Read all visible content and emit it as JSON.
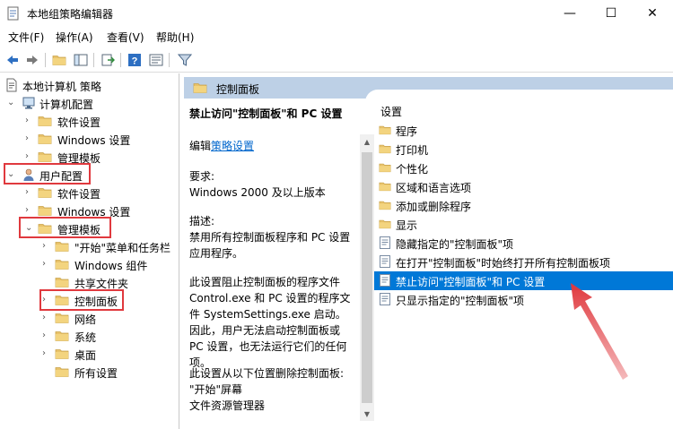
{
  "window": {
    "title": "本地组策略编辑器",
    "minimize": "—",
    "maximize": "☐",
    "close": "✕"
  },
  "menu": [
    "文件(F)",
    "操作(A)",
    "查看(V)",
    "帮助(H)"
  ],
  "toolbar": {
    "icons": [
      "back-arrow-icon",
      "forward-arrow-icon",
      "up-folder-icon",
      "show-hide-tree-icon",
      "export-list-icon",
      "help-icon",
      "properties-icon",
      "filter-icon"
    ]
  },
  "tree": {
    "root": "本地计算机 策略",
    "computer_config": "计算机配置",
    "cc_software": "软件设置",
    "cc_windows": "Windows 设置",
    "cc_admin": "管理模板",
    "user_config": "用户配置",
    "uc_software": "软件设置",
    "uc_windows": "Windows 设置",
    "uc_admin": "管理模板",
    "start_menu": "\"开始\"菜单和任务栏",
    "windows_components": "Windows 组件",
    "shared_folders": "共享文件夹",
    "control_panel": "控制面板",
    "network": "网络",
    "system": "系统",
    "desktop": "桌面",
    "all_settings": "所有设置"
  },
  "detail": {
    "header": "控制面板",
    "policy_title": "禁止访问\"控制面板\"和 PC 设置",
    "edit_prefix": "编辑",
    "edit_link": "策略设置",
    "req_label": "要求:",
    "req_value": "Windows 2000 及以上版本",
    "desc_label": "描述:",
    "desc_text": "禁用所有控制面板程序和 PC 设置应用程序。",
    "desc_more": "此设置阻止控制面板的程序文件 Control.exe 和 PC 设置的程序文件 SystemSettings.exe 启动。因此，用户无法启动控制面板或 PC 设置，也无法运行它们的任何项。",
    "desc_remove": "此设置从以下位置删除控制面板:",
    "loc_start": "\"开始\"屏幕",
    "loc_explorer": "文件资源管理器"
  },
  "settings": {
    "header": "设置",
    "items": [
      {
        "label": "程序",
        "type": "folder"
      },
      {
        "label": "打印机",
        "type": "folder"
      },
      {
        "label": "个性化",
        "type": "folder"
      },
      {
        "label": "区域和语言选项",
        "type": "folder"
      },
      {
        "label": "添加或删除程序",
        "type": "folder"
      },
      {
        "label": "显示",
        "type": "folder"
      },
      {
        "label": "隐藏指定的\"控制面板\"项",
        "type": "policy"
      },
      {
        "label": "在打开\"控制面板\"时始终打开所有控制面板项",
        "type": "policy"
      },
      {
        "label": "禁止访问\"控制面板\"和 PC 设置",
        "type": "policy",
        "selected": true
      },
      {
        "label": "只显示指定的\"控制面板\"项",
        "type": "policy"
      }
    ]
  },
  "colors": {
    "selection": "#0078d7",
    "header_band": "#bdd0e6",
    "annotation": "#e0393e",
    "folder": "#e8c26a"
  }
}
